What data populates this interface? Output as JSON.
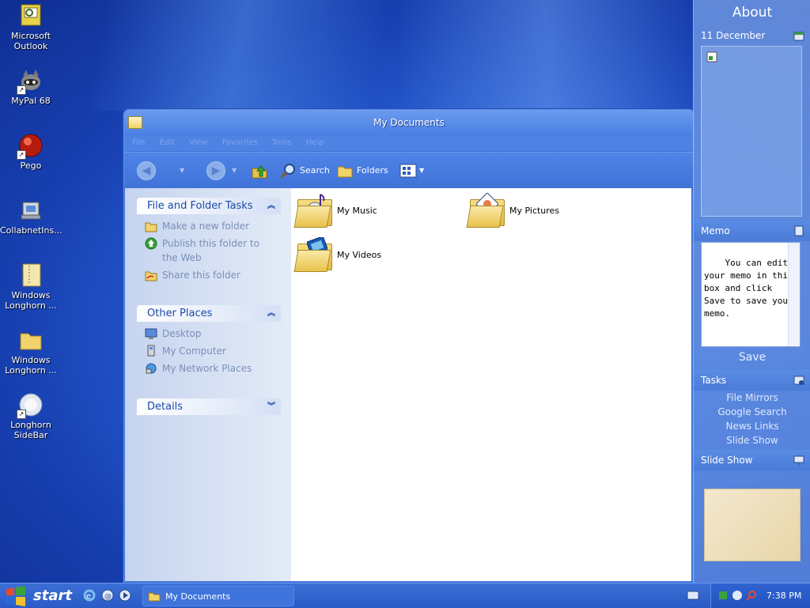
{
  "desktop": {
    "icons": [
      {
        "label": "Microsoft Outlook",
        "icon": "outlook-icon"
      },
      {
        "label": "MyPal 68",
        "icon": "mypal-icon"
      },
      {
        "label": "Pego",
        "icon": "pego-icon"
      },
      {
        "label": "CollabnetIns...",
        "icon": "installer-icon"
      },
      {
        "label": "Windows Longhorn ...",
        "icon": "document-icon"
      },
      {
        "label": "Windows Longhorn ...",
        "icon": "folder-icon"
      },
      {
        "label": "Longhorn SideBar",
        "icon": "sidebar-app-icon"
      }
    ]
  },
  "window": {
    "title": "My Documents",
    "menu": [
      "File",
      "Edit",
      "View",
      "Favorites",
      "Tools",
      "Help"
    ],
    "toolbar": {
      "search_label": "Search",
      "folders_label": "Folders"
    },
    "file_tasks": {
      "title": "File and Folder Tasks",
      "items": [
        "Make a new folder",
        "Publish this folder to the Web",
        "Share this folder"
      ]
    },
    "other_places": {
      "title": "Other Places",
      "items": [
        "Desktop",
        "My Computer",
        "My Network Places"
      ]
    },
    "details": {
      "title": "Details"
    },
    "items": [
      {
        "label": "My Music",
        "icon": "music-folder-icon"
      },
      {
        "label": "My Pictures",
        "icon": "pictures-folder-icon"
      },
      {
        "label": "My Videos",
        "icon": "videos-folder-icon"
      }
    ]
  },
  "sidebar": {
    "about": "About",
    "date": "11 December",
    "memo": {
      "title": "Memo",
      "text": "You can edit your memo in this box and click Save to save your memo.",
      "save_label": "Save"
    },
    "tasks": {
      "title": "Tasks",
      "links": [
        "File Mirrors",
        "Google Search",
        "News Links",
        "Slide Show"
      ]
    },
    "slideshow": {
      "title": "Slide Show"
    }
  },
  "taskbar": {
    "start_label": "start",
    "window_button": "My Documents",
    "clock": "7:38 PM"
  }
}
